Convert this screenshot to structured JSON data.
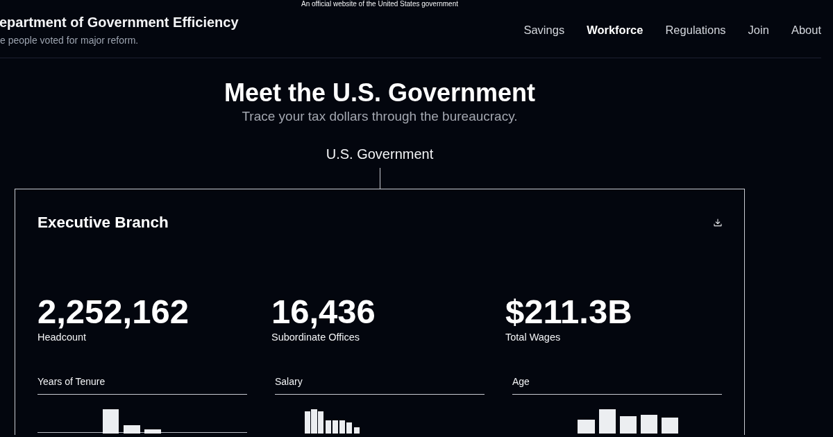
{
  "banner": {
    "text": "An official website of the United States government"
  },
  "header": {
    "title": "epartment of Government Efficiency",
    "tagline": "e people voted for major reform."
  },
  "nav": [
    {
      "label": "Savings",
      "selected": false
    },
    {
      "label": "Workforce",
      "selected": true
    },
    {
      "label": "Regulations",
      "selected": false
    },
    {
      "label": "Join",
      "selected": false
    },
    {
      "label": "About",
      "selected": false
    }
  ],
  "hero": {
    "title": "Meet the U.S. Government",
    "subtitle": "Trace your tax dollars through the bureaucracy."
  },
  "tree": {
    "root": "U.S. Government",
    "card": {
      "title": "Executive Branch",
      "stats": [
        {
          "value": "2,252,162",
          "label": "Headcount"
        },
        {
          "value": "16,436",
          "label": "Subordinate Offices"
        },
        {
          "value": "$211.3B",
          "label": "Total Wages"
        }
      ],
      "histograms": [
        {
          "title": "Years of Tenure"
        },
        {
          "title": "Salary"
        },
        {
          "title": "Age"
        }
      ]
    }
  }
}
